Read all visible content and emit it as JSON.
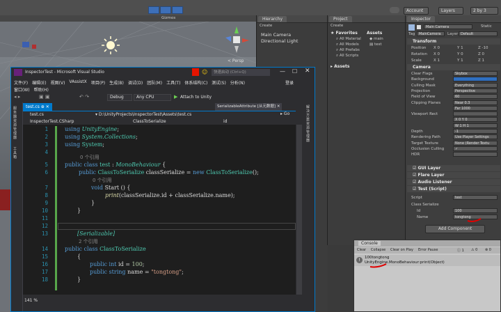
{
  "unity": {
    "toolbar": {
      "account": "Account",
      "layers": "Layers",
      "layout": "2 by 3",
      "gizmos": "Gizmos"
    },
    "scene": {
      "persp_label": "< Persp"
    },
    "hierarchy": {
      "tab": "Hierarchy",
      "create": "Create",
      "items": [
        "Main Camera",
        "Directional Light"
      ]
    },
    "project": {
      "tab": "Project",
      "create": "Create",
      "favorites_header": "Favorites",
      "favorites": [
        "All Material",
        "All Models",
        "All Prefabs",
        "All Scripts"
      ],
      "assets_header": "Assets",
      "assets": [
        "main",
        "test"
      ],
      "assets_folder": "Assets"
    },
    "inspector": {
      "tab": "Inspector",
      "object_name": "Main Camera",
      "static": "Static",
      "tag_label": "Tag",
      "tag_value": "MainCamera",
      "layer_label": "Layer",
      "layer_value": "Default",
      "transform": {
        "title": "Transform",
        "rows": [
          {
            "label": "Position",
            "x": "0",
            "y": "1",
            "z": "-10"
          },
          {
            "label": "Rotation",
            "x": "0",
            "y": "0",
            "z": "0"
          },
          {
            "label": "Scale",
            "x": "1",
            "y": "1",
            "z": "1"
          }
        ]
      },
      "camera": {
        "title": "Camera",
        "rows": [
          {
            "label": "Clear Flags",
            "value": "Skybox"
          },
          {
            "label": "Background",
            "value": ""
          },
          {
            "label": "Culling Mask",
            "value": "Everything"
          },
          {
            "label": "Projection",
            "value": "Perspective"
          },
          {
            "label": "Field of View",
            "value": "60"
          },
          {
            "label": "Clipping Planes",
            "value": "Near 0.3"
          },
          {
            "label": "",
            "value": "Far 1000"
          },
          {
            "label": "Viewport Rect",
            "value": ""
          },
          {
            "label": "",
            "value": "X 0     Y 0"
          },
          {
            "label": "",
            "value": "W 1     H 1"
          },
          {
            "label": "Depth",
            "value": "-1"
          },
          {
            "label": "Rendering Path",
            "value": "Use Player Settings"
          },
          {
            "label": "Target Texture",
            "value": "None (Render Textu"
          },
          {
            "label": "Occlusion Culling",
            "value": "✓"
          },
          {
            "label": "HDR",
            "value": ""
          }
        ]
      },
      "components": [
        "GUI Layer",
        "Flare Layer",
        "Audio Listener",
        "Test (Script)"
      ],
      "script": {
        "label": "Script",
        "value": "test"
      },
      "class_serialize": {
        "label": "Class Serialize",
        "id_label": "Id",
        "id_value": "100",
        "name_label": "Name",
        "name_value": "tongtong"
      },
      "add_component": "Add Component"
    },
    "console": {
      "tab": "Console",
      "buttons": [
        "Clear",
        "Collapse",
        "Clear on Play",
        "Error Pause"
      ],
      "counts": [
        "1",
        "0",
        "0"
      ],
      "message_line1": "100tongtong",
      "message_line2": "UnityEngine.MonoBehaviour:print(Object)"
    }
  },
  "vs": {
    "title": "InspectorTest - Microsoft Visual Studio",
    "quick_launch": "快速启动 (Ctrl+Q)",
    "menu": [
      "文件(F)",
      "编辑(E)",
      "视图(V)",
      "VAssistX",
      "项目(P)",
      "生成(B)",
      "调试(D)",
      "团队(M)",
      "工具(T)",
      "体系结构(C)",
      "测试(S)",
      "分析(N)"
    ],
    "menu_row2": [
      "窗口(W)",
      "帮助(H)"
    ],
    "login": "登录",
    "debug": "Debug",
    "cpu": "Any CPU",
    "attach": "Attach to Unity",
    "tabs": {
      "file": "test.cs",
      "attr": "SerializableAttribute [从元数据]"
    },
    "nav": {
      "file": "test.cs",
      "path": "D:\\UnityProjects\\InspectorTest\\Assets\\test.cs",
      "go": "Go"
    },
    "nav2": {
      "project": "InspectorTest.CSharp",
      "class": "ClassToSerialize",
      "member": "id"
    },
    "zoom": "141 %",
    "side_tabs": [
      "服务器资源管理器",
      "工具箱"
    ],
    "code": {
      "l1": [
        "using",
        "UnityEngine",
        ";"
      ],
      "l2": [
        "using",
        "System.Collections",
        ";"
      ],
      "l3": [
        "using",
        "System",
        ";"
      ],
      "ref0": "0 个引用",
      "l5": [
        "public",
        "class",
        "test",
        ":",
        "MonoBehaviour",
        "{"
      ],
      "l6": [
        "public",
        "ClassToSerialize",
        "classSerialize",
        "=",
        "new",
        "ClassToSerialize",
        "();"
      ],
      "ref1": "0 个引用",
      "l7": [
        "void",
        "Start",
        "() {"
      ],
      "l8": [
        "print",
        "(classSerialize.id + classSerialize.name);"
      ],
      "l9": "}",
      "l10": "}",
      "l12": "[Serializable]",
      "ref2": "2 个引用",
      "l13": [
        "public",
        "class",
        "ClassToSerialize"
      ],
      "l14": "{",
      "l15": [
        "public",
        "int",
        "id =",
        "100",
        ";"
      ],
      "l16": [
        "public",
        "string",
        "name =",
        "\"tongtong\"",
        ";"
      ],
      "l17": "}",
      "line_numbers": [
        "1",
        "2",
        "3",
        "4",
        "5",
        "6",
        "7",
        "8",
        "9",
        "10",
        "11",
        "12",
        "13",
        "14",
        "15",
        "16",
        "17",
        "18"
      ]
    },
    "right_tabs": [
      "解决方案资源管理器",
      "团队资源管理器",
      "类视图"
    ]
  }
}
